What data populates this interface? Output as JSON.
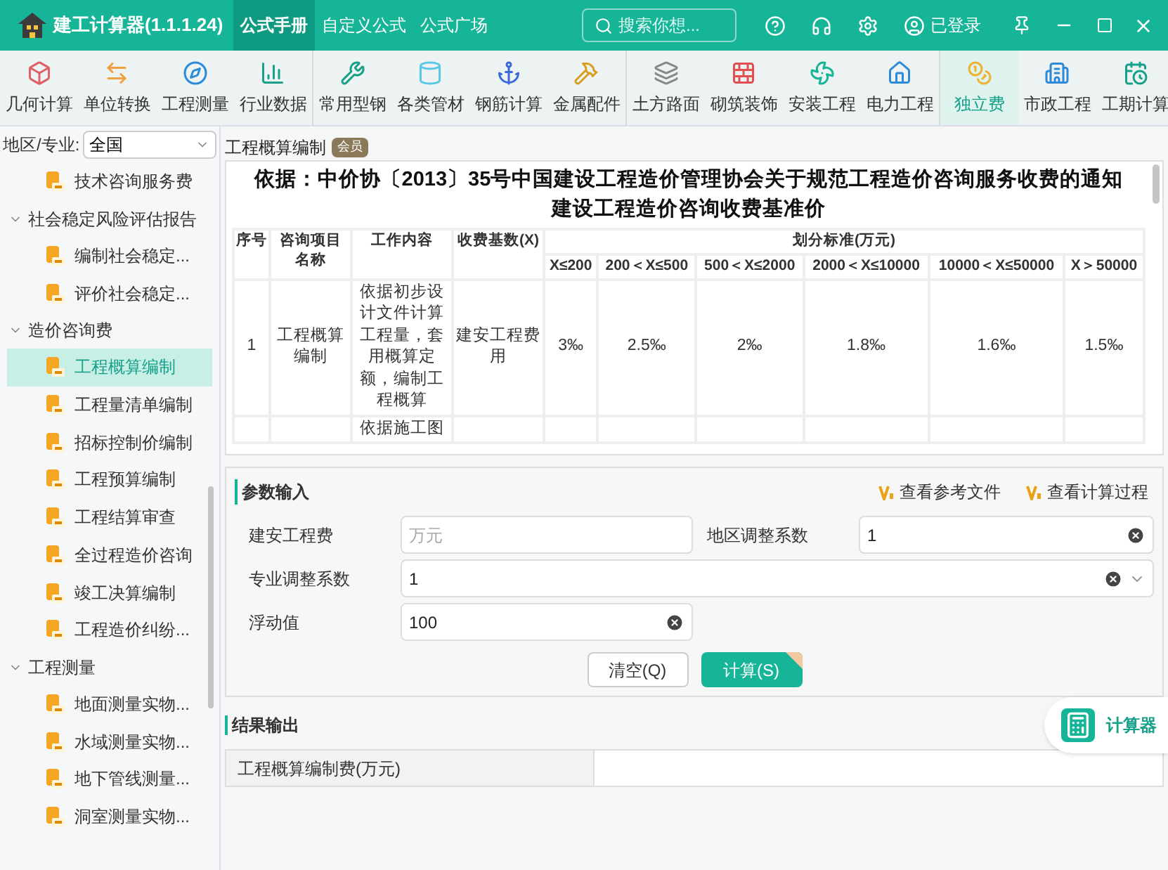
{
  "window": {
    "title": "建工计算器(1.1.1.24)"
  },
  "nav_tabs": [
    {
      "label": "公式手册",
      "selected": true
    },
    {
      "label": "自定义公式",
      "selected": false
    },
    {
      "label": "公式广场",
      "selected": false
    }
  ],
  "search": {
    "placeholder": "搜索你想..."
  },
  "account": {
    "label": "已登录"
  },
  "toolbar": {
    "groups": [
      {
        "items": [
          {
            "label": "几何计算",
            "selected": false
          },
          {
            "label": "单位转换",
            "selected": false
          },
          {
            "label": "工程测量",
            "selected": false
          },
          {
            "label": "行业数据",
            "selected": false
          }
        ]
      },
      {
        "items": [
          {
            "label": "常用型钢",
            "selected": false
          },
          {
            "label": "各类管材",
            "selected": false
          },
          {
            "label": "钢筋计算",
            "selected": false
          },
          {
            "label": "金属配件",
            "selected": false
          }
        ]
      },
      {
        "items": [
          {
            "label": "土方路面",
            "selected": false
          },
          {
            "label": "砌筑装饰",
            "selected": false
          },
          {
            "label": "安装工程",
            "selected": false
          },
          {
            "label": "电力工程",
            "selected": false
          }
        ]
      },
      {
        "items": [
          {
            "label": "独立费",
            "selected": true
          },
          {
            "label": "市政工程",
            "selected": false
          },
          {
            "label": "工期计算",
            "selected": false
          }
        ]
      }
    ]
  },
  "region": {
    "label": "地区/专业:",
    "value": "全国"
  },
  "sidebar": {
    "tree": [
      {
        "children": [
          {
            "label": "技术咨询服务费",
            "selected": false
          }
        ]
      },
      {
        "label": "社会稳定风险评估报告",
        "expanded": true,
        "children": [
          {
            "label": "编制社会稳定...",
            "selected": false
          },
          {
            "label": "评价社会稳定...",
            "selected": false
          }
        ]
      },
      {
        "label": "造价咨询费",
        "expanded": true,
        "children": [
          {
            "label": "工程概算编制",
            "selected": true
          },
          {
            "label": "工程量清单编制",
            "selected": false
          },
          {
            "label": "招标控制价编制",
            "selected": false
          },
          {
            "label": "工程预算编制",
            "selected": false
          },
          {
            "label": "工程结算审查",
            "selected": false
          },
          {
            "label": "全过程造价咨询",
            "selected": false
          },
          {
            "label": "竣工决算编制",
            "selected": false
          },
          {
            "label": "工程造价纠纷...",
            "selected": false
          }
        ]
      },
      {
        "label": "工程测量",
        "expanded": true,
        "children": [
          {
            "label": "地面测量实物...",
            "selected": false
          },
          {
            "label": "水域测量实物...",
            "selected": false
          },
          {
            "label": "地下管线测量...",
            "selected": false
          },
          {
            "label": "洞室测量实物...",
            "selected": false
          }
        ]
      }
    ]
  },
  "page": {
    "title": "工程概算编制",
    "badge": "会员"
  },
  "table": {
    "heading": [
      "依据：中价协〔2013〕35号中国建设工程造价管理协会关于规范工程造价咨询服务收费的通知",
      "建设工程造价咨询收费基准价"
    ],
    "columns": [
      "序号",
      "咨询项目名称",
      "工作内容",
      "收费基数(X)"
    ],
    "group_column": "划分标准(万元)",
    "sub_columns": [
      "X≤200",
      "200＜X≤500",
      "500＜X≤2000",
      "2000＜X≤10000",
      "10000＜X≤50000",
      "X＞50000"
    ],
    "rows": [
      [
        "1",
        "工程概算编制",
        "依据初步设计文件计算工程量，套用概算定额，编制工程概算",
        "建安工程费用",
        "3‰",
        "2.5‰",
        "2‰",
        "1.8‰",
        "1.6‰",
        "1.5‰"
      ],
      [
        "",
        "",
        "依据施工图",
        "",
        "",
        "",
        "",
        "",
        "",
        ""
      ]
    ]
  },
  "params": {
    "title": "参数输入",
    "links": [
      "查看参考文件",
      "查看计算过程"
    ],
    "fields": [
      {
        "label": "建安工程费",
        "placeholder": "万元",
        "kind": "text"
      },
      {
        "label": "地区调整系数",
        "value": "1",
        "kind": "clearable"
      },
      {
        "label": "专业调整系数",
        "value": "1",
        "kind": "select"
      },
      {
        "label": "浮动值",
        "value": "100",
        "kind": "clearable"
      }
    ],
    "buttons": [
      {
        "label": "清空(Q)",
        "kind": "secondary"
      },
      {
        "label": "计算(S)",
        "kind": "primary"
      }
    ]
  },
  "results": {
    "title": "结果输出",
    "rows": [
      {
        "label": "工程概算编制费(万元)"
      }
    ]
  },
  "calculator_button": {
    "label": "计算器"
  }
}
